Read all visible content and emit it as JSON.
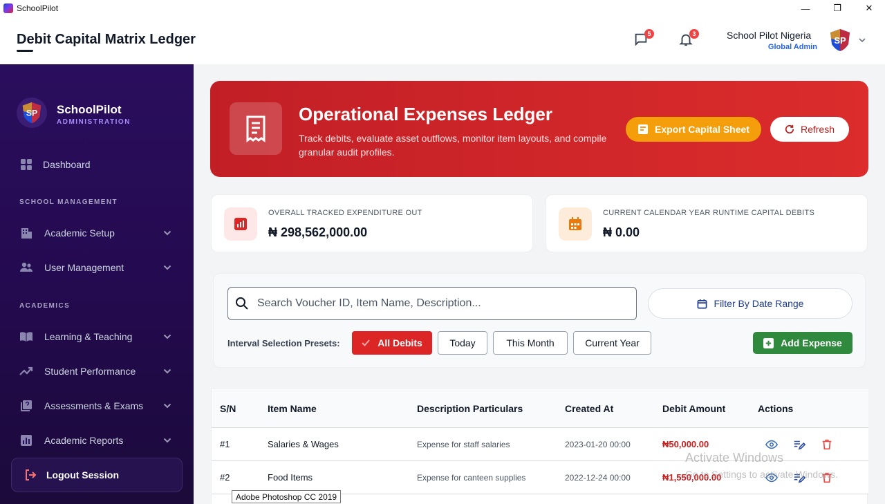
{
  "window": {
    "title": "SchoolPilot",
    "minimize": "—",
    "maximize": "❐",
    "close": "✕"
  },
  "header": {
    "page_title": "Debit Capital Matrix Ledger",
    "messages_count": "5",
    "notifications_count": "3",
    "user_name": "School Pilot Nigeria",
    "user_role": "Global Admin"
  },
  "sidebar": {
    "brand_name": "SchoolPilot",
    "brand_sub": "ADMINISTRATION",
    "dashboard": "Dashboard",
    "section_school": "SCHOOL MANAGEMENT",
    "academic_setup": "Academic Setup",
    "user_management": "User Management",
    "section_academics": "ACADEMICS",
    "learning_teaching": "Learning & Teaching",
    "student_performance": "Student Performance",
    "assessments_exams": "Assessments & Exams",
    "academic_reports": "Academic Reports",
    "logout": "Logout Session"
  },
  "hero": {
    "title": "Operational Expenses Ledger",
    "description": "Track debits, evaluate asset outflows, monitor item layouts, and compile granular audit profiles.",
    "export_label": "Export Capital Sheet",
    "refresh_label": "Refresh"
  },
  "stats": {
    "overall_label": "OVERALL TRACKED EXPENDITURE OUT",
    "overall_value": "₦ 298,562,000.00",
    "year_label": "CURRENT CALENDAR YEAR RUNTIME CAPITAL DEBITS",
    "year_value": "₦ 0.00"
  },
  "filters": {
    "search_placeholder": "Search Voucher ID, Item Name, Description...",
    "date_range_label": "Filter By Date Range",
    "presets_label": "Interval Selection Presets:",
    "preset_all": "All Debits",
    "preset_today": "Today",
    "preset_month": "This Month",
    "preset_year": "Current Year",
    "add_expense": "Add Expense"
  },
  "table": {
    "headers": {
      "sn": "S/N",
      "item": "Item Name",
      "desc": "Description Particulars",
      "created": "Created At",
      "amount": "Debit Amount",
      "actions": "Actions"
    },
    "rows": [
      {
        "sn": "#1",
        "item": "Salaries & Wages",
        "desc": "Expense for staff salaries",
        "created": "2023-01-20 00:00",
        "amount": "₦50,000.00"
      },
      {
        "sn": "#2",
        "item": "Food Items",
        "desc": "Expense for canteen supplies",
        "created": "2022-12-24 00:00",
        "amount": "₦1,550,000.00"
      }
    ]
  },
  "overlays": {
    "watermark_title": "Activate Windows",
    "watermark_sub": "Go to Settings to activate Windows.",
    "tooltip": "Adobe Photoshop CC 2019"
  },
  "colors": {
    "sidebar_bg": "#2a0e5e",
    "hero_red": "#c11f26",
    "export_orange": "#f59e0b",
    "add_green": "#2f8a3e",
    "amount_red": "#c81e1e",
    "role_blue": "#2563eb"
  },
  "icons": {
    "app": "schoolpilot-logo-icon",
    "messages": "chat-icon",
    "notifications": "bell-icon",
    "receipt": "receipt-icon",
    "search": "search-icon",
    "calendar": "calendar-icon"
  }
}
